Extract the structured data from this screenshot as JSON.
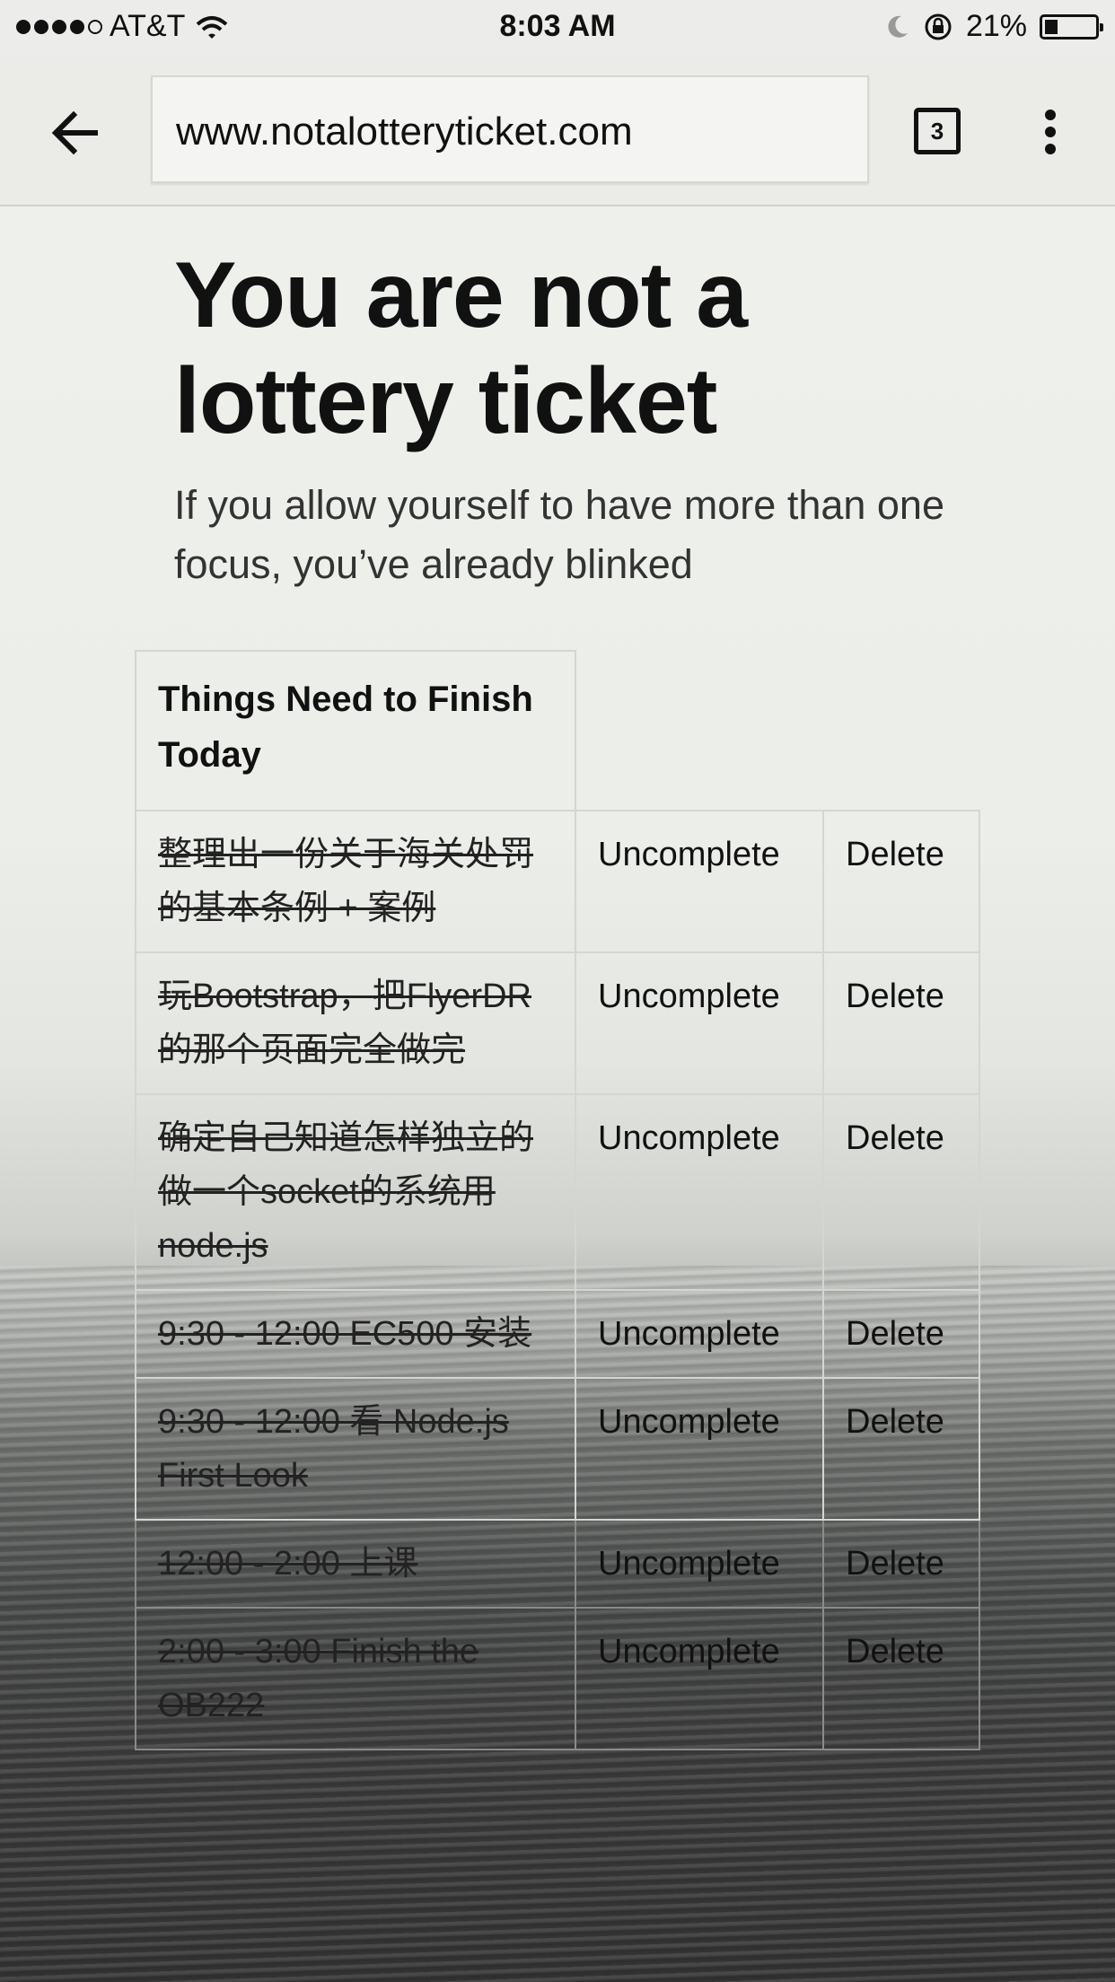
{
  "status_bar": {
    "carrier": "AT&T",
    "time": "8:03 AM",
    "battery": "21%",
    "battery_level": 0.21
  },
  "browser": {
    "url": "www.notalotteryticket.com",
    "tab_count": "3",
    "icons": {
      "back": "back-arrow-icon",
      "menu": "overflow-menu-icon"
    }
  },
  "page": {
    "headline": "You are not a lottery ticket",
    "subtitle": "If you allow yourself to have more than one focus, you’ve already blinked",
    "table_header": "Things Need to Finish Today",
    "tasks": [
      {
        "text": "整理出一份关于海关处罚的基本条例 + 案例",
        "complete_label": "Uncomplete",
        "delete_label": "Delete"
      },
      {
        "text": "玩Bootstrap，把FlyerDR的那个页面完全做完",
        "complete_label": "Uncomplete",
        "delete_label": "Delete"
      },
      {
        "text": "确定自己知道怎样独立的做一个socket的系统用node.js",
        "complete_label": "Uncomplete",
        "delete_label": "Delete"
      },
      {
        "text": "9:30 - 12:00 EC500 安装",
        "complete_label": "Uncomplete",
        "delete_label": "Delete"
      },
      {
        "text": "9:30 - 12:00 看 Node.js First Look",
        "complete_label": "Uncomplete",
        "delete_label": "Delete"
      },
      {
        "text": "12:00 - 2:00 上课",
        "complete_label": "Uncomplete",
        "delete_label": "Delete"
      },
      {
        "text": "2:00 - 3:00 Finish the OB222",
        "complete_label": "Uncomplete",
        "delete_label": "Delete"
      }
    ]
  }
}
